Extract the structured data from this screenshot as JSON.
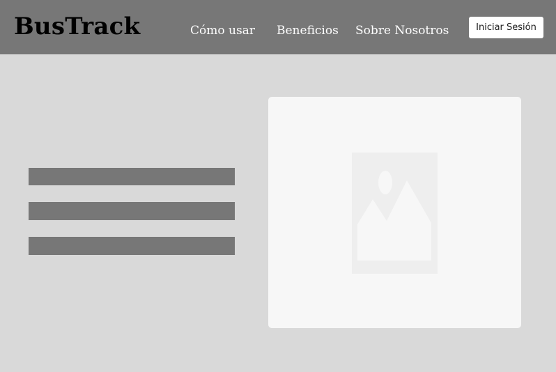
{
  "header": {
    "logo": "BusTrack",
    "nav": [
      {
        "label": "Cómo usar"
      },
      {
        "label": "Beneficios"
      },
      {
        "label": "Sobre Nosotros"
      }
    ],
    "login_label": "Iniciar Sesión"
  },
  "hero": {
    "image_icon": "image-placeholder-icon"
  },
  "colors": {
    "header_bg": "#777777",
    "page_bg": "#d9d9d9",
    "card_bg": "#f7f7f7",
    "placeholder_bar": "#777777"
  }
}
